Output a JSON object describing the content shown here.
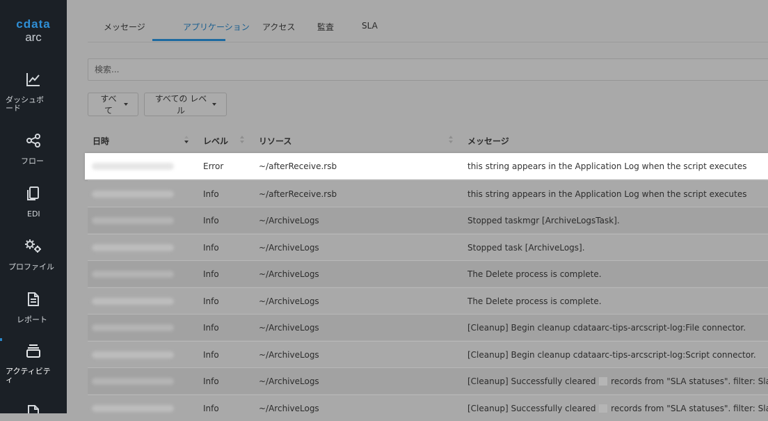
{
  "app": {
    "logo_text": "cdata",
    "logo_sub": "arc"
  },
  "sidebar": {
    "items": [
      {
        "label": "ダッシュボード",
        "icon": "chart-line-icon"
      },
      {
        "label": "フロー",
        "icon": "flow-nodes-icon"
      },
      {
        "label": "EDI",
        "icon": "documents-icon"
      },
      {
        "label": "プロファイル",
        "icon": "gears-icon"
      },
      {
        "label": "レポート",
        "icon": "report-icon"
      },
      {
        "label": "アクティビティ",
        "icon": "activity-stack-icon",
        "active": true
      },
      {
        "label": "",
        "icon": "document-icon"
      }
    ]
  },
  "tabs": [
    {
      "label": "メッセージ"
    },
    {
      "label": "アプリケーション",
      "active": true
    },
    {
      "label": "アクセス"
    },
    {
      "label": "監査"
    },
    {
      "label": "SLA"
    }
  ],
  "search": {
    "placeholder": "検索..."
  },
  "filters": {
    "all_label": "すべて",
    "level_label": "すべての レベル"
  },
  "table": {
    "headers": {
      "datetime": "日時",
      "level": "レベル",
      "resource": "リソース",
      "message": "メッセージ"
    },
    "rows": [
      {
        "level": "Error",
        "resource": "~/afterReceive.rsb",
        "message": "this string appears in the Application Log when the script executes"
      },
      {
        "level": "Info",
        "resource": "~/afterReceive.rsb",
        "message": "this string appears in the Application Log when the script executes"
      },
      {
        "level": "Info",
        "resource": "~/ArchiveLogs",
        "message": "Stopped taskmgr [ArchiveLogsTask]."
      },
      {
        "level": "Info",
        "resource": "~/ArchiveLogs",
        "message": "Stopped task [ArchiveLogs]."
      },
      {
        "level": "Info",
        "resource": "~/ArchiveLogs",
        "message": "The Delete process is complete."
      },
      {
        "level": "Info",
        "resource": "~/ArchiveLogs",
        "message": "The Delete process is complete."
      },
      {
        "level": "Info",
        "resource": "~/ArchiveLogs",
        "message": "[Cleanup] Begin cleanup cdataarc-tips-arcscript-log:File connector."
      },
      {
        "level": "Info",
        "resource": "~/ArchiveLogs",
        "message": "[Cleanup] Begin cleanup cdataarc-tips-arcscript-log:Script connector."
      },
      {
        "level": "Info",
        "resource": "~/ArchiveLogs",
        "message_pre": "[Cleanup] Successfully cleared",
        "message_post": "records from \"SLA statuses\". filter: SlaStatus"
      },
      {
        "level": "Info",
        "resource": "~/ArchiveLogs",
        "message_pre": "[Cleanup] Successfully cleared",
        "message_post": "records from \"SLA statuses\". filter: SlaStatus"
      }
    ]
  },
  "colors": {
    "accent": "#1d6aa0",
    "error": "#c0393b",
    "sidebar_bg": "#1b2026"
  }
}
